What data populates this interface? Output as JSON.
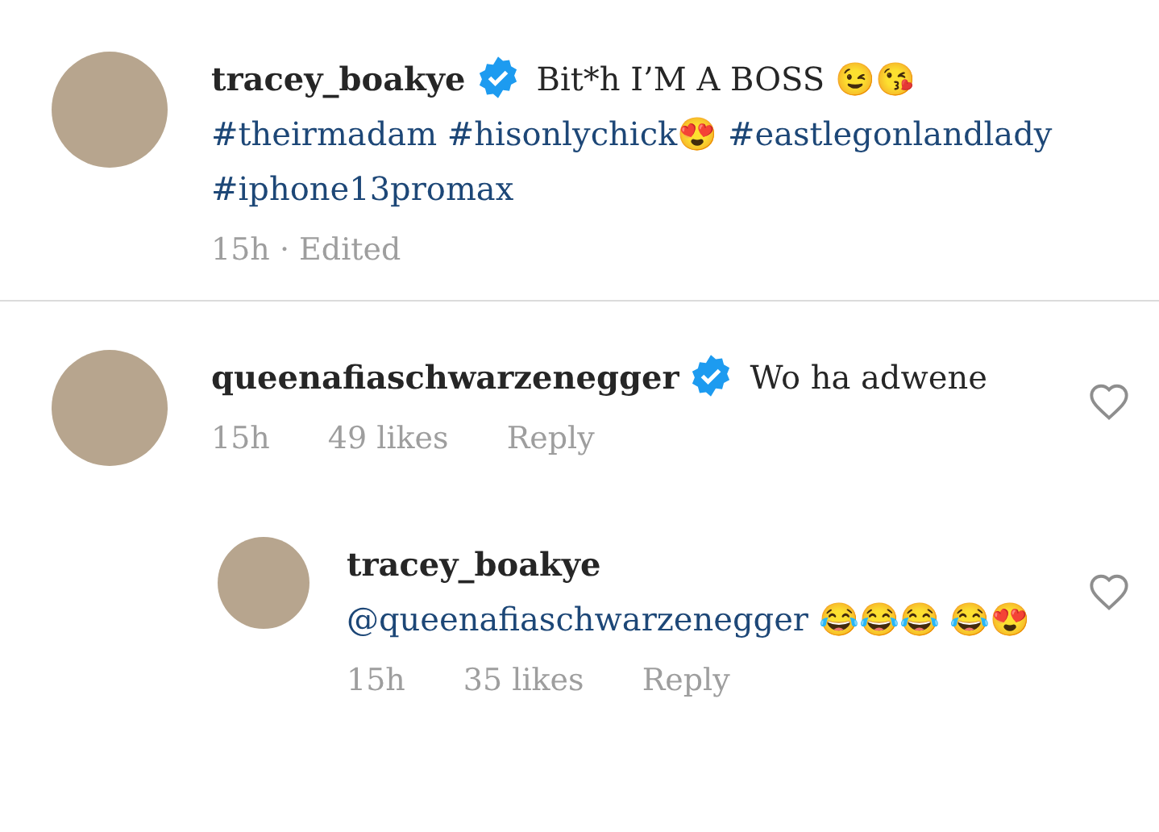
{
  "caption": {
    "username": "tracey_boakye",
    "verified": true,
    "parts": [
      {
        "kind": "text",
        "text": "Bit*h I’M A BOSS 😉😘"
      },
      {
        "kind": "tag",
        "text": "#theirmadam"
      },
      {
        "kind": "tag",
        "text": "#hisonlychick😍"
      },
      {
        "kind": "tag",
        "text": "#eastlegonlandlady"
      },
      {
        "kind": "tag",
        "text": "#iphone13promax"
      }
    ],
    "time": "15h · Edited"
  },
  "comments": [
    {
      "username": "queenafiaschwarzenegger",
      "verified": true,
      "liked": false,
      "parts": [
        {
          "kind": "text",
          "text": "Wo ha adwene"
        }
      ],
      "time": "15h",
      "likes": "49 likes",
      "reply": "Reply",
      "children": [
        {
          "username": "tracey_boakye",
          "liked": false,
          "parts": [
            {
              "kind": "mention",
              "text": "@queenafiaschwarzenegger"
            },
            {
              "kind": "text",
              "text": "😂😂😂 😂😍"
            }
          ],
          "time": "15h",
          "likes": "35 likes",
          "reply": "Reply"
        }
      ]
    }
  ]
}
